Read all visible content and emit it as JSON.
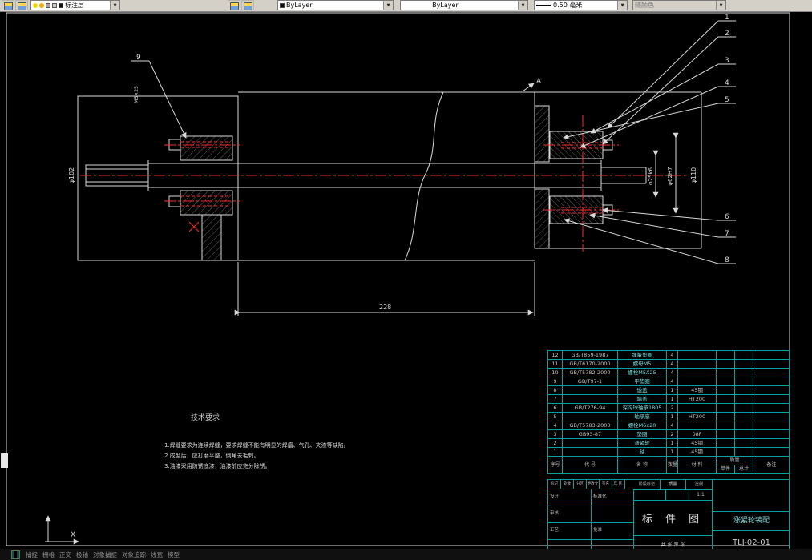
{
  "toolbar": {
    "layer": {
      "value": "标注层"
    },
    "color": {
      "value": "ByLayer"
    },
    "linetype": {
      "value": "ByLayer"
    },
    "lineweight": {
      "value": "0.50 毫米"
    },
    "plotstyle": {
      "value": "随颜色"
    }
  },
  "drawing": {
    "balloons": [
      "1",
      "2",
      "3",
      "4",
      "5",
      "6",
      "7",
      "8",
      "9"
    ],
    "dims": {
      "len": "228",
      "dia_left": "φ102",
      "dia_right": "φ110",
      "fit_shaft": "φ25k6",
      "fit_bore": "φ62H7",
      "section_label": "A",
      "thread_callout": "M5×25"
    },
    "tech": {
      "title": "技术要求",
      "lines": [
        "1.焊缝要求为连续焊缝，要求焊缝不能有明显的焊瘤、气孔、夹渣等缺陷。",
        "2.成型后，应打磨平整，倒角去毛刺。",
        "3.油漆采用防锈底漆，油漆前应充分除锈。"
      ]
    },
    "ucs_x": "X"
  },
  "bom": {
    "headers": {
      "no": "序号",
      "code": "代 号",
      "name": "名 称",
      "qty": "数量",
      "material": "材 料",
      "mass": "质量",
      "unit": "单件",
      "total": "总计",
      "remark": "备注"
    },
    "rows": [
      {
        "no": "12",
        "code": "GB/T859-1987",
        "name": "弹簧垫圈",
        "qty": "4",
        "material": "",
        "unit": "",
        "total": "",
        "remark": ""
      },
      {
        "no": "11",
        "code": "GB/T6170-2000",
        "name": "螺母M5",
        "qty": "4",
        "material": "",
        "unit": "",
        "total": "",
        "remark": ""
      },
      {
        "no": "10",
        "code": "GB/T5782-2000",
        "name": "螺栓M5X25",
        "qty": "4",
        "material": "",
        "unit": "",
        "total": "",
        "remark": ""
      },
      {
        "no": "9",
        "code": "GB/T97-1",
        "name": "平垫圈",
        "qty": "4",
        "material": "",
        "unit": "",
        "total": "",
        "remark": ""
      },
      {
        "no": "8",
        "code": "",
        "name": "透盖",
        "qty": "1",
        "material": "45钢",
        "unit": "",
        "total": "",
        "remark": ""
      },
      {
        "no": "7",
        "code": "",
        "name": "端盖",
        "qty": "1",
        "material": "HT200",
        "unit": "",
        "total": "",
        "remark": ""
      },
      {
        "no": "6",
        "code": "GB/T276-94",
        "name": "深沟球轴承1805",
        "qty": "2",
        "material": "",
        "unit": "",
        "total": "",
        "remark": ""
      },
      {
        "no": "5",
        "code": "",
        "name": "轴承座",
        "qty": "1",
        "material": "HT200",
        "unit": "",
        "total": "",
        "remark": ""
      },
      {
        "no": "4",
        "code": "GB/T5783-2000",
        "name": "螺栓M6x20",
        "qty": "4",
        "material": "",
        "unit": "",
        "total": "",
        "remark": ""
      },
      {
        "no": "3",
        "code": "GB93-87",
        "name": "垫圈",
        "qty": "2",
        "material": "08F",
        "unit": "",
        "total": "",
        "remark": ""
      },
      {
        "no": "2",
        "code": "",
        "name": "涨紧轮",
        "qty": "1",
        "material": "45钢",
        "unit": "",
        "total": "",
        "remark": ""
      },
      {
        "no": "1",
        "code": "",
        "name": "轴",
        "qty": "1",
        "material": "45钢",
        "unit": "",
        "total": "",
        "remark": ""
      }
    ]
  },
  "titleblock": {
    "rev_row": [
      "标记",
      "处数",
      "分区",
      "更改文件号",
      "签名",
      "年.月.日"
    ],
    "sign_rows": [
      [
        "设计",
        "标准化"
      ],
      [
        "审核",
        ""
      ],
      [
        "工艺",
        "批准"
      ],
      [
        "",
        ""
      ]
    ],
    "stage_row": [
      "阶段标记",
      "质量",
      "比例"
    ],
    "scale": "1:1",
    "doc_title": "标 件 图",
    "sheet_note": "共 张  第 张",
    "product_name": "涨紧轮装配",
    "drawing_no": "TLJ-02-01"
  },
  "statusbar": {
    "toggles": [
      "捕捉",
      "栅格",
      "正交",
      "极轴",
      "对象捕捉",
      "对象追踪",
      "线宽",
      "模型"
    ]
  }
}
